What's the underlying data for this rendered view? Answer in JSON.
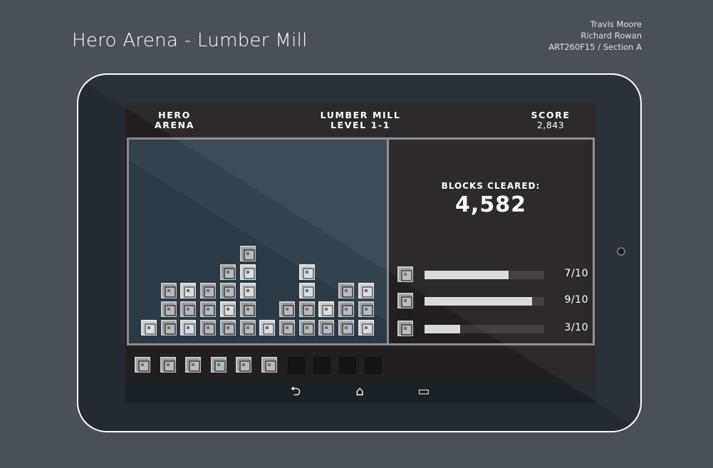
{
  "page": {
    "title": "Hero Arena - Lumber Mill",
    "credits": [
      "Travis Moore",
      "Richard Rowan",
      "ART260F15 / Section A"
    ]
  },
  "hud": {
    "game_name_line1": "HERO",
    "game_name_line2": "ARENA",
    "level_name": "LUMBER MILL",
    "level_number": "LEVEL 1-1",
    "score_label": "SCORE",
    "score_value": "2,843"
  },
  "stats": {
    "blocks_cleared_label": "BLOCKS CLEARED:",
    "blocks_cleared_value": "4,582",
    "rows": [
      {
        "text": "7/10",
        "fraction": 0.7
      },
      {
        "text": "9/10",
        "fraction": 0.9
      },
      {
        "text": "3/10",
        "fraction": 0.3
      }
    ]
  },
  "board": {
    "columns": [
      [
        1
      ],
      [
        0,
        0,
        0
      ],
      [
        1,
        0,
        1
      ],
      [
        0,
        0,
        0
      ],
      [
        0,
        1,
        0,
        0
      ],
      [
        0,
        0,
        1,
        1,
        0
      ],
      [
        1
      ],
      [
        0,
        0
      ],
      [
        0,
        0,
        1,
        1
      ],
      [
        0,
        1
      ],
      [
        0,
        0,
        0
      ],
      [
        1,
        0,
        1
      ]
    ]
  },
  "tray": {
    "filled_count": 6,
    "empty_count": 4
  },
  "navbar": {
    "buttons": [
      {
        "icon": "back-icon",
        "glyph": "⮌"
      },
      {
        "icon": "home-icon",
        "glyph": "⌂"
      },
      {
        "icon": "recents-icon",
        "glyph": "▭"
      }
    ]
  }
}
